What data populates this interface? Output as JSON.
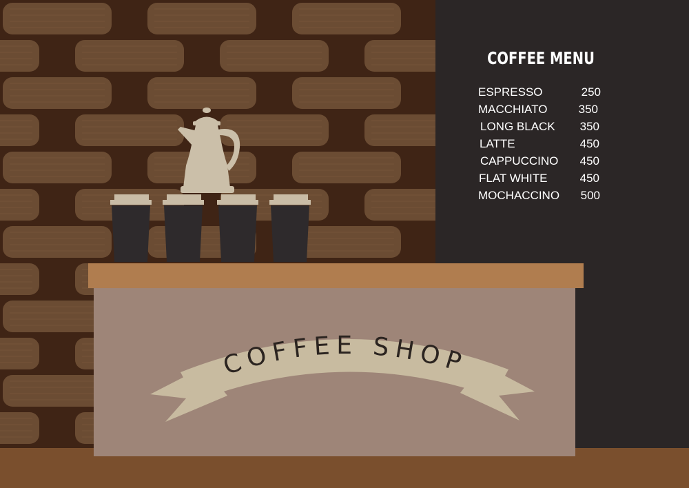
{
  "menu": {
    "title": "COFFEE   MENU",
    "items": [
      {
        "name": "ESPRESSO",
        "price": "250"
      },
      {
        "name": "MACCHIATO",
        "price": "350"
      },
      {
        "name": "LONG BLACK",
        "price": "350"
      },
      {
        "name": "LATTE",
        "price": "450"
      },
      {
        "name": "CAPPUCCINO",
        "price": "450"
      },
      {
        "name": "FLAT  WHITE",
        "price": "450"
      },
      {
        "name": "MOCHACCINO",
        "price": "500"
      }
    ]
  },
  "banner": {
    "text": "COFFEE SHOP"
  },
  "colors": {
    "wall_dark": "#3f2415",
    "plank": "#6b4c33",
    "board": "#2b2626",
    "counter_top": "#b07d4f",
    "counter_body": "#9e8578",
    "banner": "#c8bba0",
    "cups": "#2e2a2c",
    "lids": "#c9bca6",
    "pot": "#cbbfa9",
    "floor": "#7a4f2d"
  },
  "objects": {
    "cups_count_label": "",
    "pot": "coffee-pot-icon",
    "cup": "takeaway-cup-icon"
  }
}
